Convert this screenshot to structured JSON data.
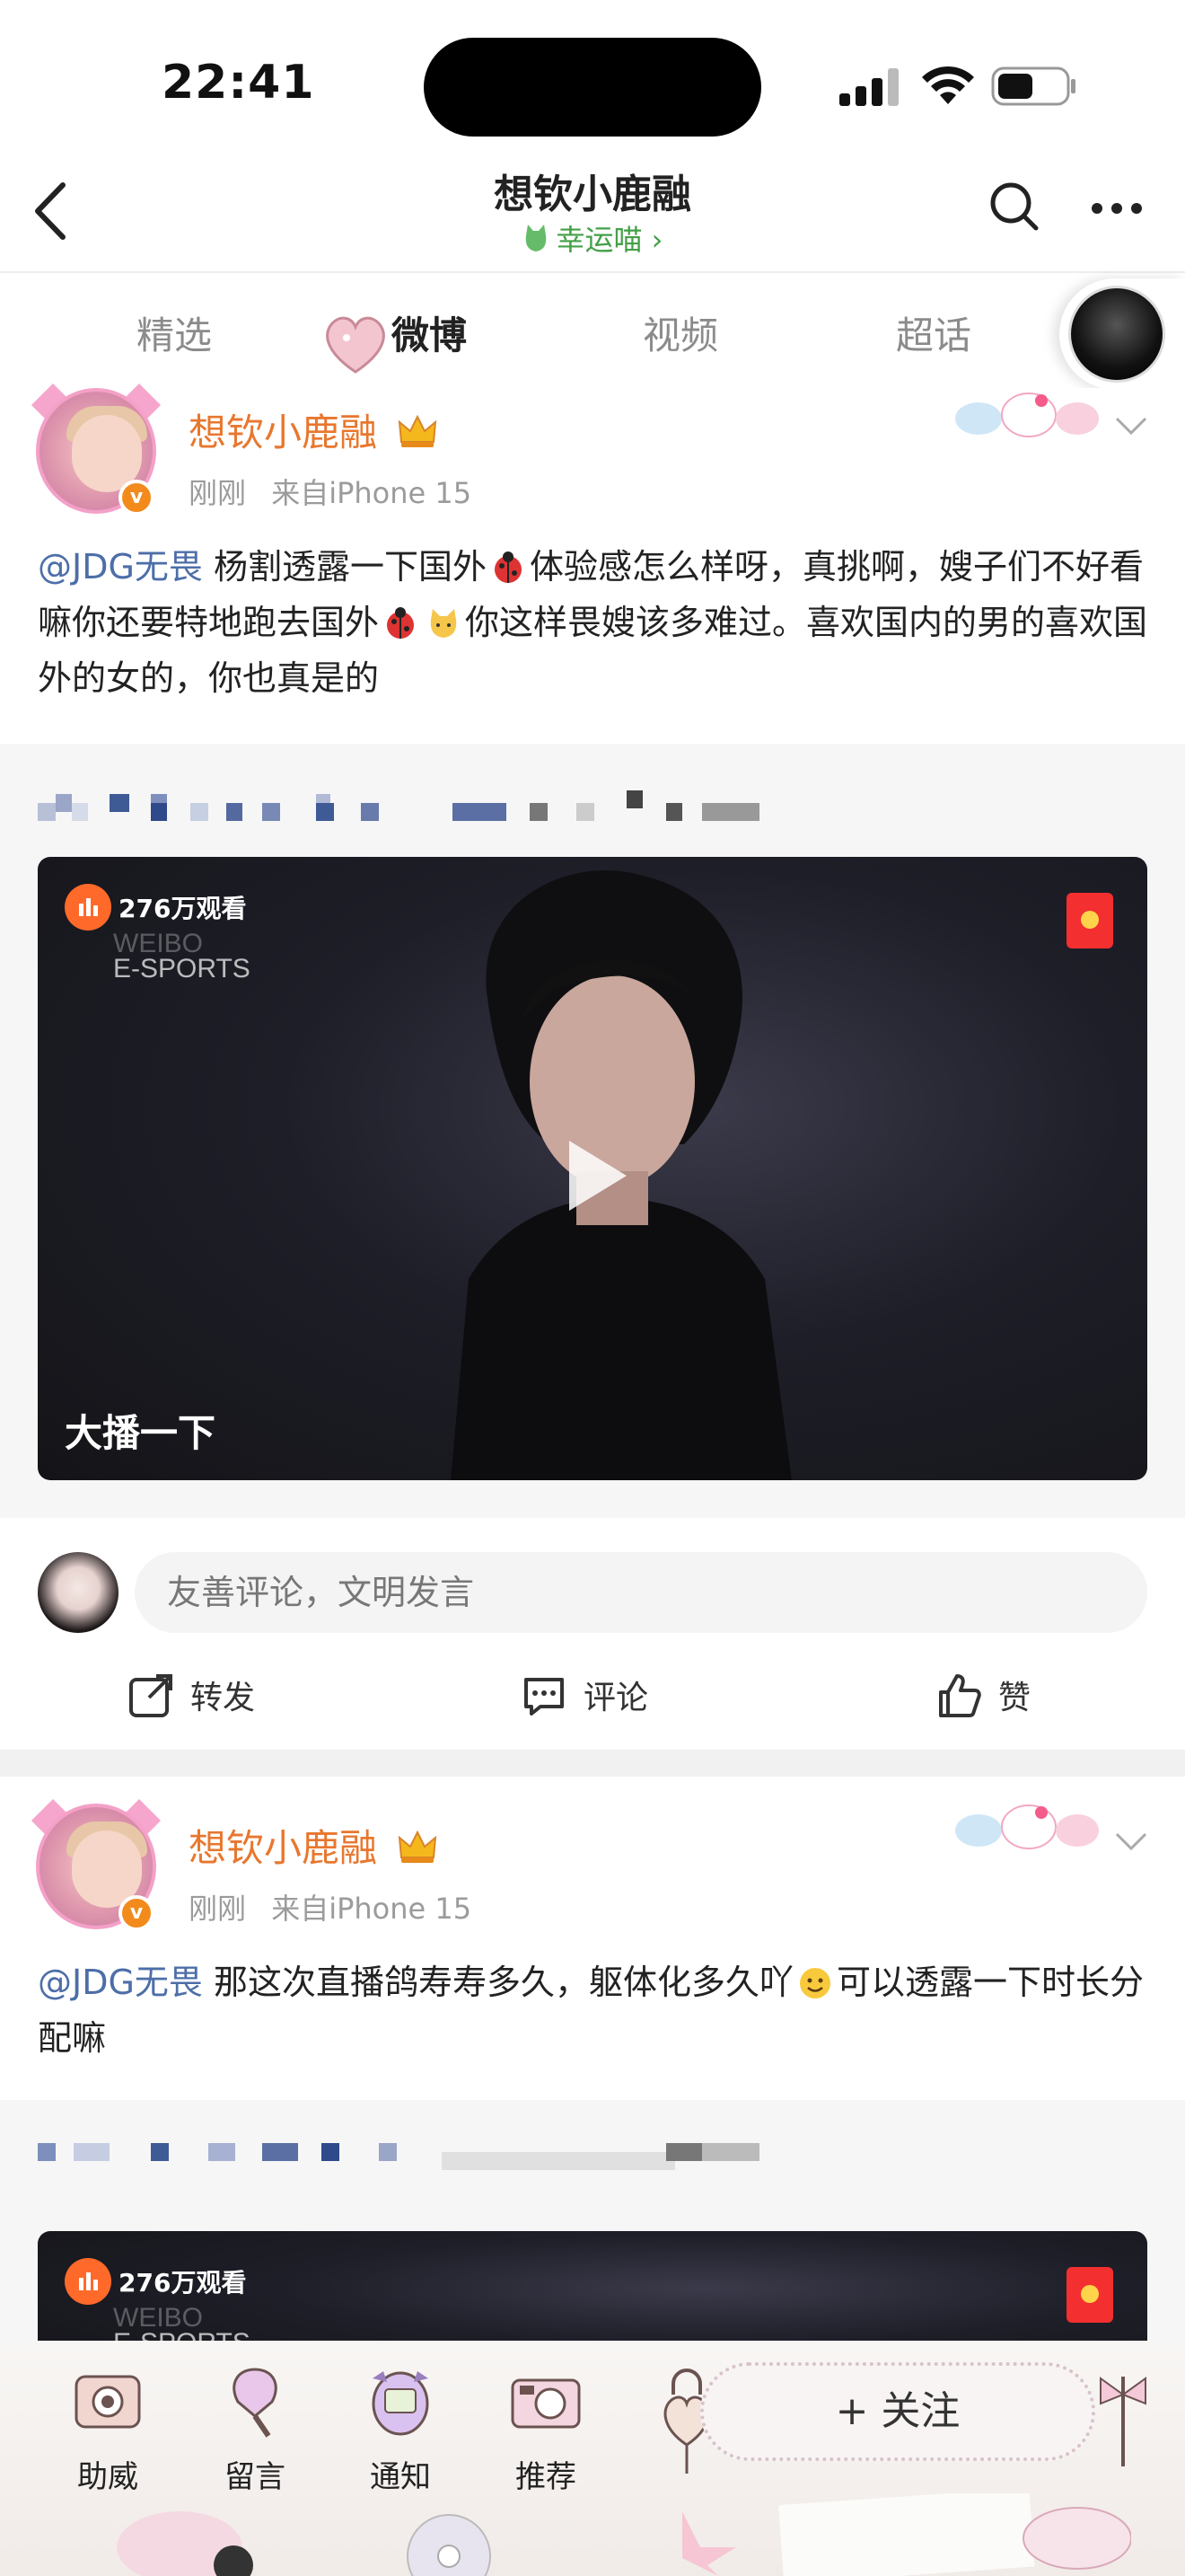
{
  "status_bar": {
    "time": "22:41"
  },
  "header": {
    "title": "想钦小鹿融",
    "subtitle": "幸运喵 ›"
  },
  "tabs": [
    {
      "label": "精选"
    },
    {
      "label": "微博"
    },
    {
      "label": "视频"
    },
    {
      "label": "超话"
    }
  ],
  "posts": [
    {
      "username": "想钦小鹿融",
      "time": "刚刚",
      "source": "来自iPhone 15",
      "mention": "@JDG无畏",
      "text_a": " 杨割透露一下国外",
      "text_b": "体验感怎么样呀，真挑啊，嫂子们不好看嘛你还要特地跑去国外",
      "text_c": "你这样畏嫂该多难过。喜欢国内的男的喜欢国外的女的，你也真是的",
      "video": {
        "views": "276万观看",
        "watermark_line1": "WEIBO",
        "watermark_line2": "E-SPORTS",
        "caption": "大播一下"
      }
    },
    {
      "username": "想钦小鹿融",
      "time": "刚刚",
      "source": "来自iPhone 15",
      "mention": "@JDG无畏",
      "text_a": " 那这次直播鸽寿寿多久，躯体化多久吖",
      "text_b": "可以透露一下时长分配嘛",
      "video": {
        "views": "276万观看",
        "watermark_line1": "WEIBO",
        "watermark_line2": "E-SPORTS"
      }
    }
  ],
  "comment": {
    "placeholder": "友善评论，文明发言"
  },
  "actions": {
    "repost": "转发",
    "comment": "评论",
    "like": "赞"
  },
  "bottom_bar": {
    "items": [
      {
        "label": "助威",
        "icon": "camera-icon"
      },
      {
        "label": "留言",
        "icon": "mirror-icon"
      },
      {
        "label": "通知",
        "icon": "tamagotchi-icon"
      },
      {
        "label": "推荐",
        "icon": "retro-camera-icon"
      }
    ],
    "follow": "+ 关注"
  },
  "colors": {
    "username": "#e8772e",
    "mention": "#4d6ea8",
    "lucky": "#43a047",
    "views_dot": "#ff6a2a"
  }
}
